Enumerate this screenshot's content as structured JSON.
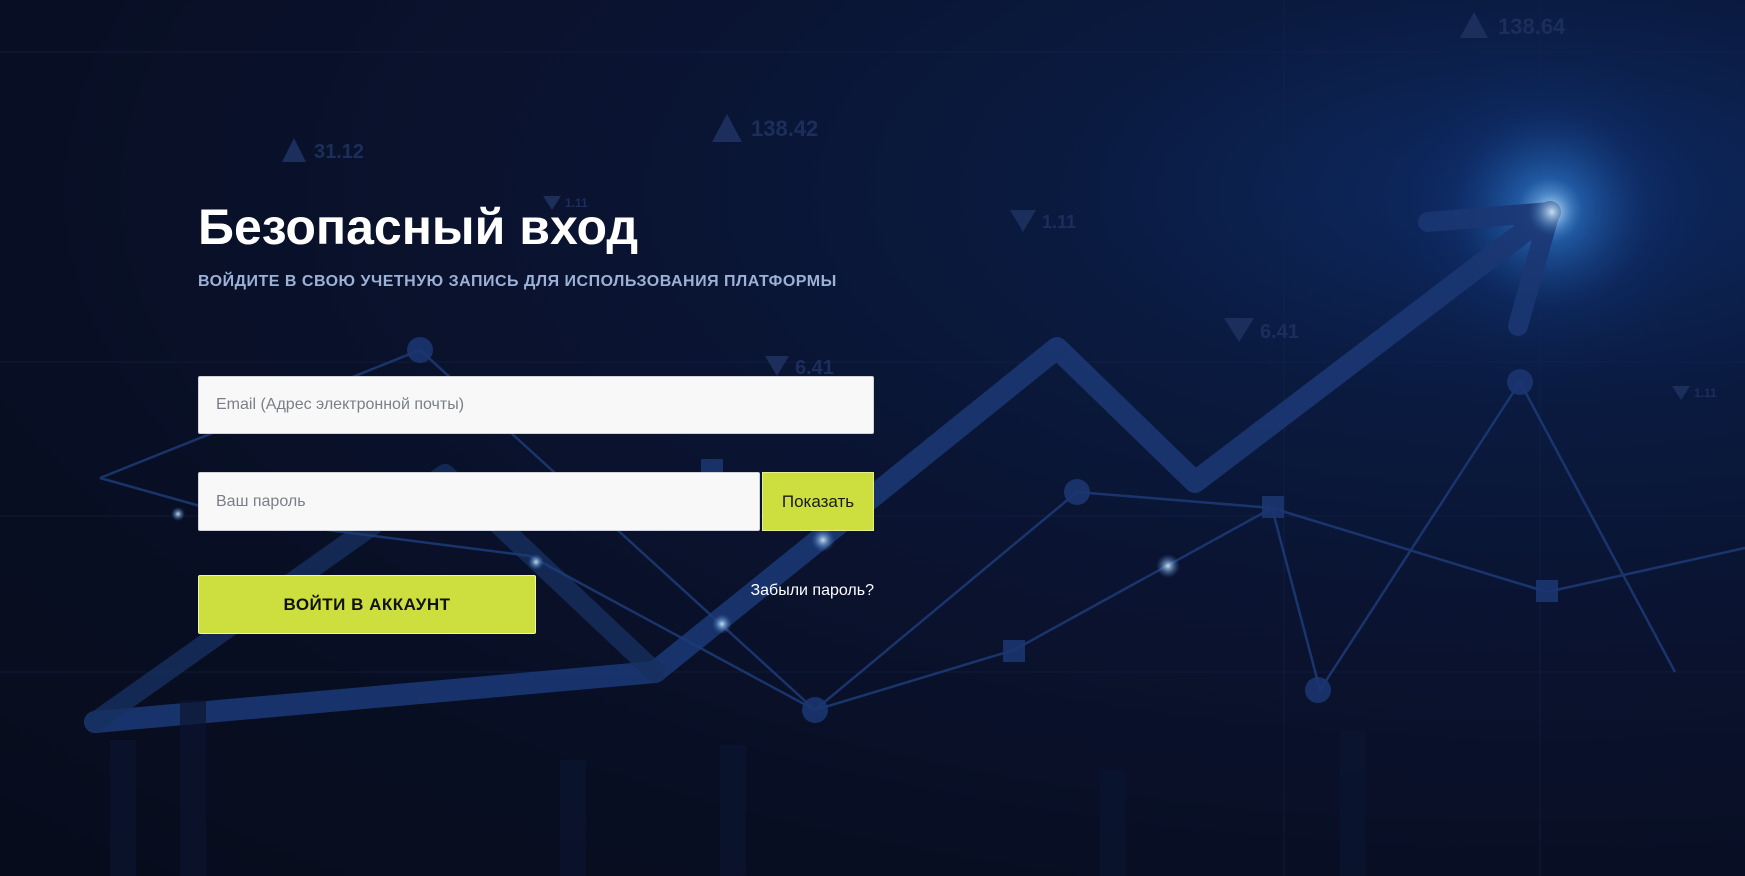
{
  "login": {
    "title": "Безопасный вход",
    "subtitle": "ВОЙДИТЕ В СВОЮ УЧЕТНУЮ ЗАПИСЬ ДЛЯ ИСПОЛЬЗОВАНИЯ ПЛАТФОРМЫ",
    "email_placeholder": "Email (Адрес электронной почты)",
    "email_value": "",
    "password_placeholder": "Ваш пароль",
    "password_value": "",
    "show_button_label": "Показать",
    "login_button_label": "ВОЙТИ В АККАУНТ",
    "forgot_link_label": "Забыли пароль?"
  },
  "background": {
    "tickers": [
      {
        "direction": "up",
        "value": "138.64"
      },
      {
        "direction": "up",
        "value": "138.42"
      },
      {
        "direction": "up",
        "value": "31.12"
      },
      {
        "direction": "down",
        "value": "1.11"
      },
      {
        "direction": "down",
        "value": "6.41"
      },
      {
        "direction": "down",
        "value": "6.41"
      },
      {
        "direction": "down",
        "value": "1.11"
      },
      {
        "direction": "down",
        "value": "1.11"
      }
    ]
  },
  "colors": {
    "background": "#0a1124",
    "accent": "#cddf3f",
    "title": "#ffffff",
    "subtitle": "#9db1d6",
    "chart_line": "#1c3570"
  }
}
